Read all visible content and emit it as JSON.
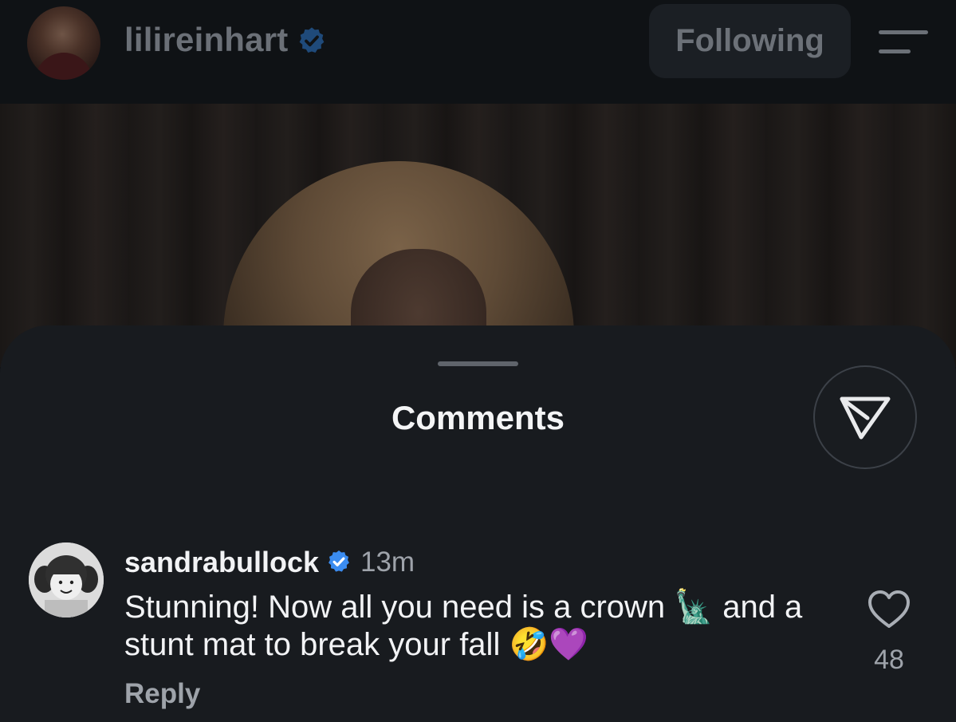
{
  "header": {
    "username": "lilireinhart",
    "following_label": "Following"
  },
  "sheet": {
    "title": "Comments"
  },
  "comment": {
    "username": "sandrabullock",
    "time": "13m",
    "text": "Stunning! Now all you need is a crown 🗽 and a stunt mat to break your fall 🤣💜",
    "reply_label": "Reply",
    "like_count": "48"
  },
  "colors": {
    "verified_blue": "#3b8cf0",
    "background": "#181b1f"
  },
  "icons": [
    "verified-badge-icon",
    "menu-icon",
    "share-send-icon",
    "heart-icon"
  ]
}
